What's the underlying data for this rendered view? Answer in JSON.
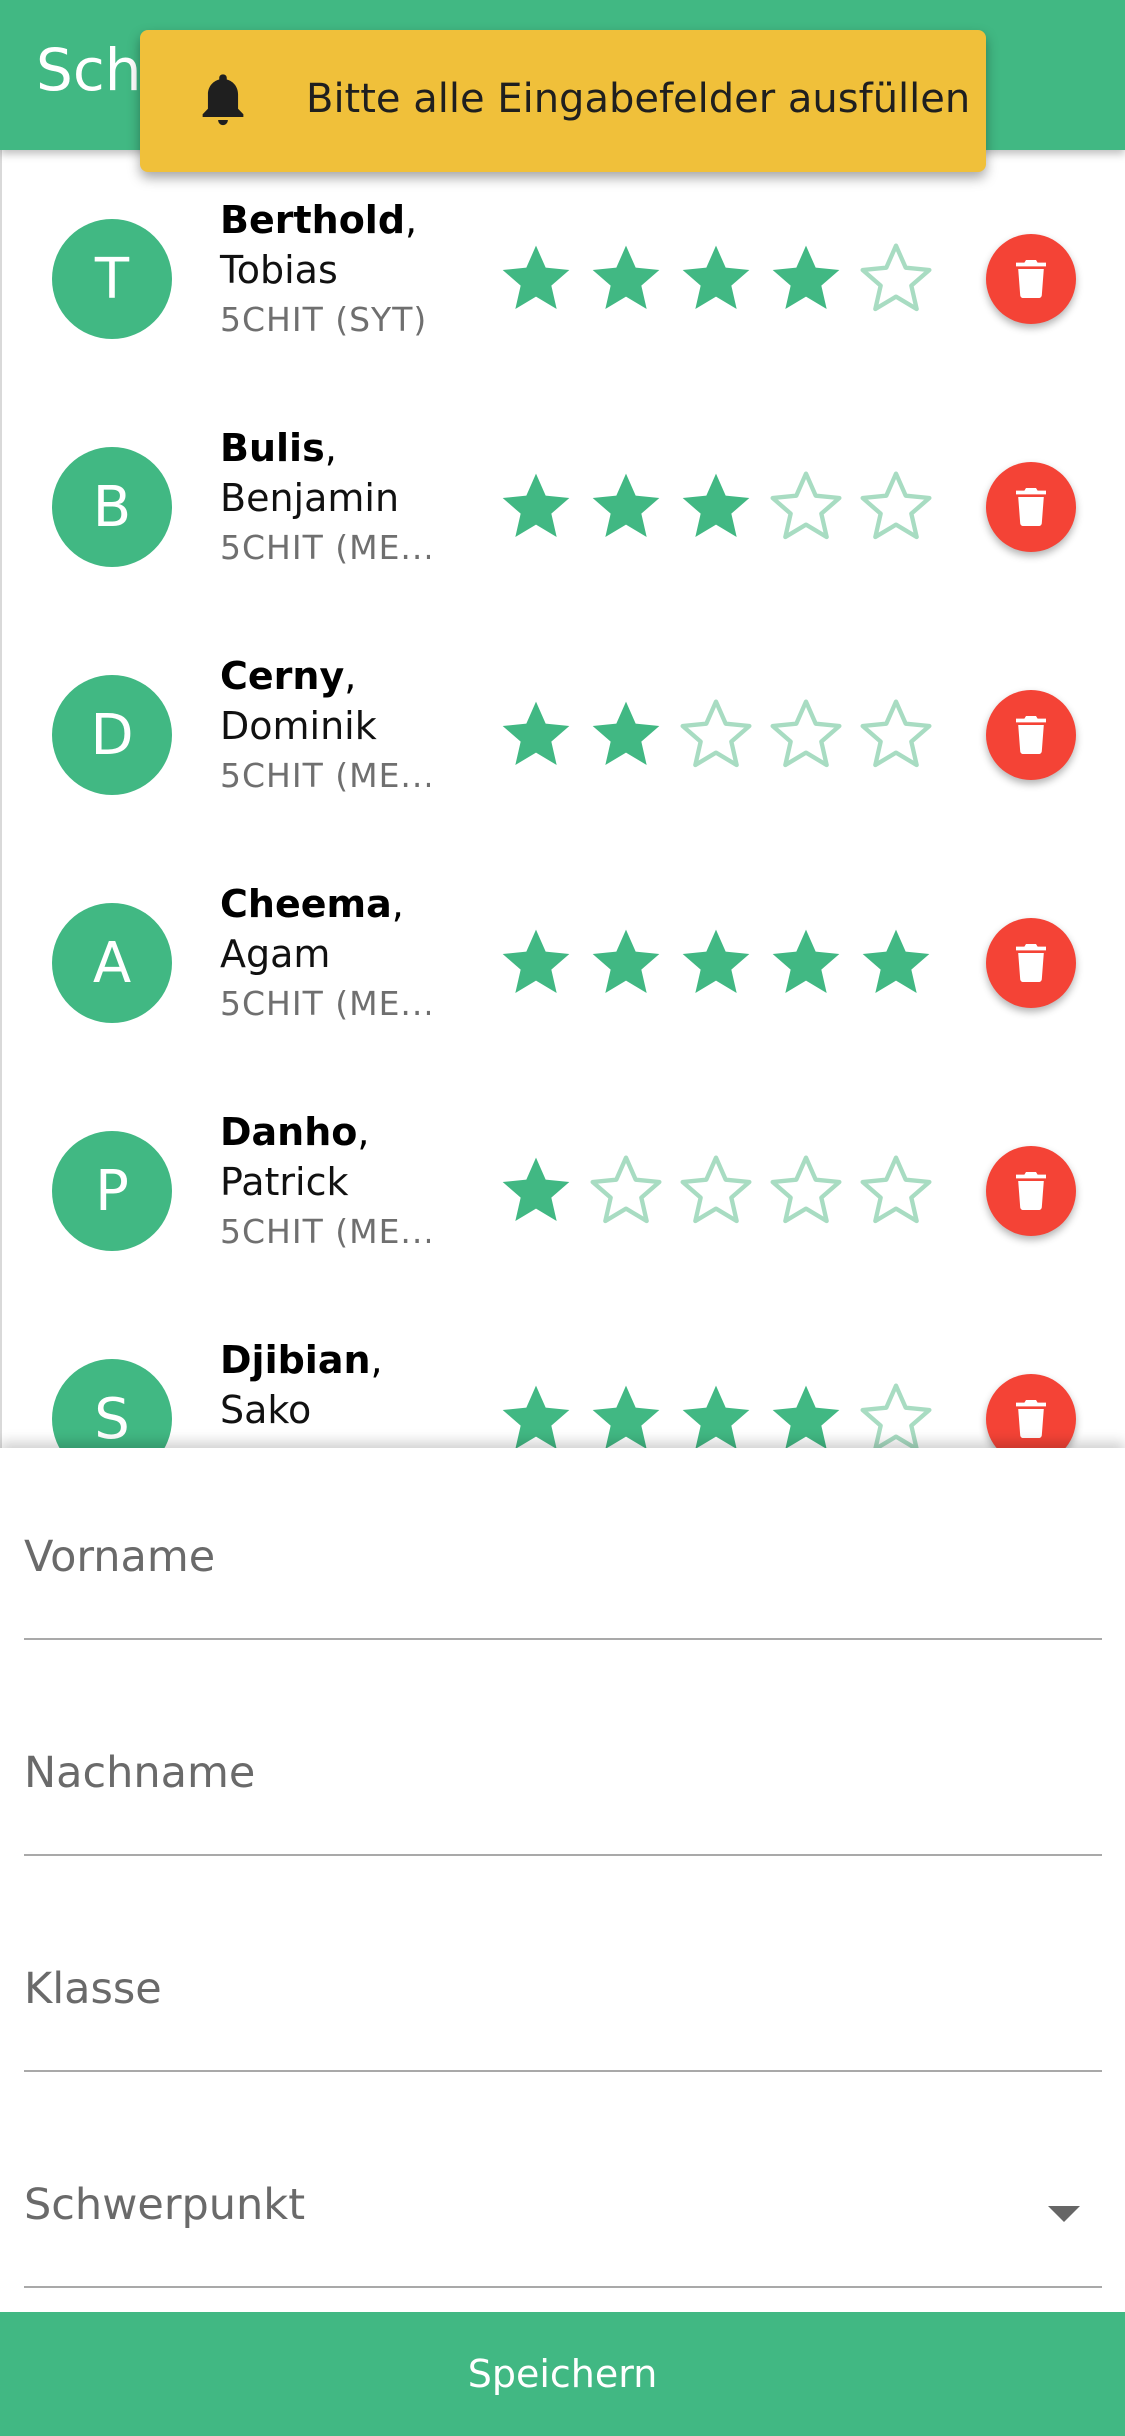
{
  "appbar": {
    "title": "Schüler"
  },
  "toast": {
    "message": "Bitte alle Eingabefelder ausfüllen",
    "icon": "bell-icon"
  },
  "colors": {
    "primary": "#41b883",
    "danger": "#f44336",
    "toast": "#f0c03a"
  },
  "students": [
    {
      "initial": "T",
      "lastname": "Berthold",
      "firstname": "Tobias",
      "klasse": "5CHIT (SYT)",
      "rating": 4
    },
    {
      "initial": "B",
      "lastname": "Bulis",
      "firstname": "Benjamin",
      "klasse": "5CHIT (ME...",
      "rating": 3
    },
    {
      "initial": "D",
      "lastname": "Cerny",
      "firstname": "Dominik",
      "klasse": "5CHIT (ME...",
      "rating": 2
    },
    {
      "initial": "A",
      "lastname": "Cheema",
      "firstname": "Agam",
      "klasse": "5CHIT (ME...",
      "rating": 5
    },
    {
      "initial": "P",
      "lastname": "Danho",
      "firstname": "Patrick",
      "klasse": "5CHIT (ME...",
      "rating": 1
    },
    {
      "initial": "S",
      "lastname": "Djibian",
      "firstname": "Sako",
      "klasse": "",
      "rating": 4
    }
  ],
  "form": {
    "vorname_label": "Vorname",
    "nachname_label": "Nachname",
    "klasse_label": "Klasse",
    "schwerpunkt_label": "Schwerpunkt",
    "save_label": "Speichern"
  }
}
